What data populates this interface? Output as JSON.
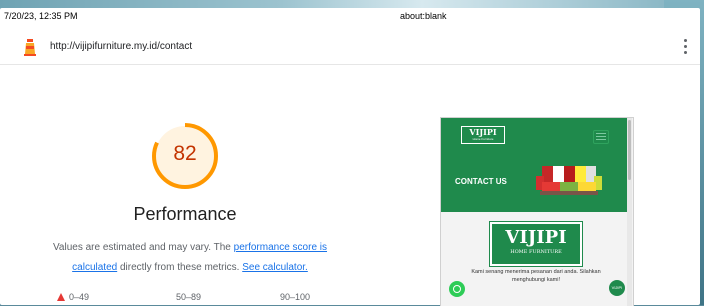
{
  "print_header": {
    "datetime": "7/20/23, 12:35 PM",
    "title": "about:blank"
  },
  "report": {
    "url": "http://vijipifurniture.my.id/contact",
    "category": "Performance",
    "score": "82",
    "score_fraction": 0.82,
    "colors": {
      "score_ring": "#ff9800",
      "score_text": "#c33300",
      "link": "#1a73e8"
    },
    "description": {
      "prefix": "Values are estimated and may vary. The ",
      "link1": "performance score is calculated",
      "middle": " directly from these metrics. ",
      "link2": "See calculator."
    },
    "legend": {
      "fail": "0–49",
      "average": "50–89",
      "pass": "90–100"
    }
  },
  "screenshot": {
    "logo_small": "VIJIPI",
    "logo_small_sub": "Home Furniture",
    "contact_heading": "CONTACT US",
    "logo_big": "VIJIPI",
    "logo_big_sub": "HOME FURNITURE",
    "message": "Kami senang menerima pesanan dari anda. Silahkan menghubungi kami!",
    "colors": {
      "brand_green": "#1f8a4c",
      "whatsapp": "#2ecc57"
    }
  }
}
